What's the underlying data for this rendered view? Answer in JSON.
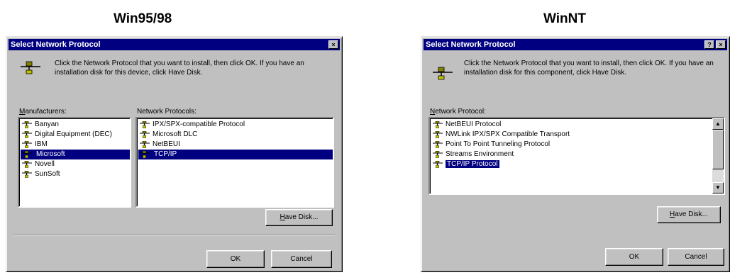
{
  "captions": {
    "left": "Win95/98",
    "right": "WinNT"
  },
  "win95": {
    "title": "Select Network Protocol",
    "close_glyph": "×",
    "instructions": "Click the Network Protocol that you want to install, then click OK. If you have an installation disk for this device, click Have Disk.",
    "manufacturers_label": "Manufacturers:",
    "manufacturers_label_accel": "M",
    "manufacturers_label_rest": "anufacturers:",
    "manufacturers": [
      "Banyan",
      "Digital Equipment (DEC)",
      "IBM",
      "Microsoft",
      "Novell",
      "SunSoft"
    ],
    "manufacturers_selected": 3,
    "protocols_label": "Network Protocols:",
    "protocols": [
      "IPX/SPX-compatible Protocol",
      "Microsoft DLC",
      "NetBEUI",
      "TCP/IP"
    ],
    "protocols_selected": 3,
    "have_disk": "Have Disk...",
    "have_disk_accel": "H",
    "have_disk_rest": "ave Disk...",
    "ok": "OK",
    "cancel": "Cancel"
  },
  "winnt": {
    "title": "Select Network Protocol",
    "help_glyph": "?",
    "close_glyph": "×",
    "instructions": "Click the Network Protocol that you want to install, then click OK. If you have an installation disk for this component, click Have Disk.",
    "protocol_label": "Network Protocol:",
    "protocol_label_accel": "N",
    "protocol_label_rest": "etwork Protocol:",
    "protocols": [
      "NetBEUI Protocol",
      "NWLink IPX/SPX Compatible Transport",
      "Point To Point Tunneling Protocol",
      "Streams Environment",
      "TCP/IP Protocol"
    ],
    "protocols_selected": 4,
    "scroll_up": "▲",
    "scroll_down": "▼",
    "have_disk": "Have Disk...",
    "have_disk_accel": "H",
    "have_disk_rest": "ave Disk...",
    "ok": "OK",
    "cancel": "Cancel"
  },
  "colors": {
    "titlebar": "#000080",
    "face": "#c0c0c0",
    "selection": "#000080"
  },
  "icons": {
    "network": "network-protocol-icon",
    "list_item": "protocol-item-icon"
  }
}
